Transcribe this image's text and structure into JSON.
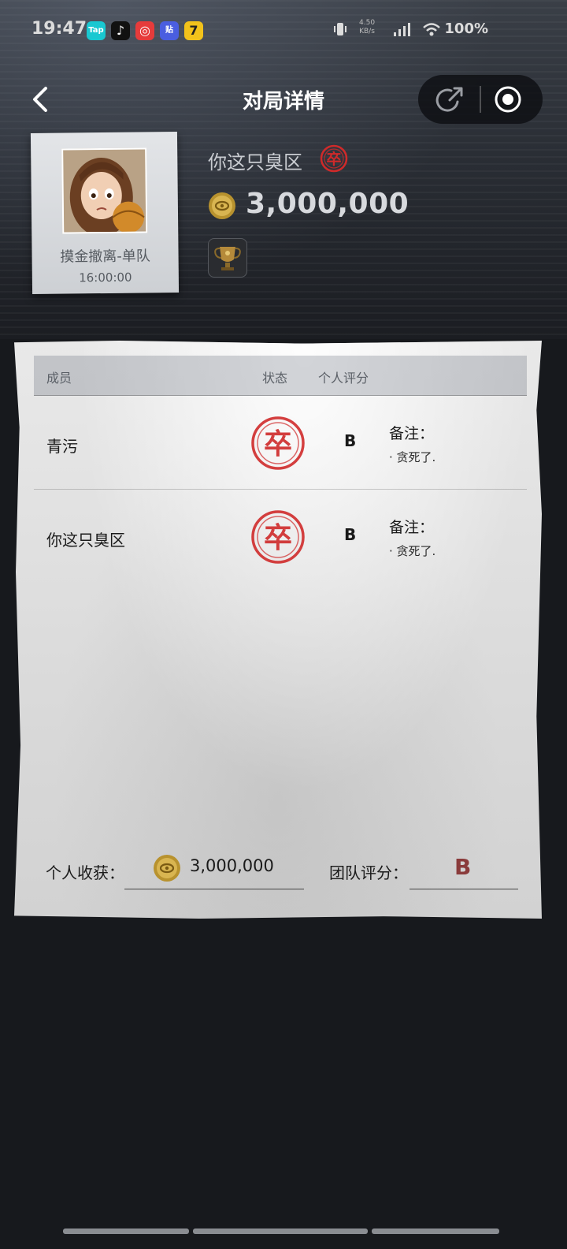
{
  "status_bar": {
    "time": "19:47",
    "apps": [
      {
        "name": "taptap-icon",
        "label": "Tap",
        "color": "#19c8d1"
      },
      {
        "name": "tiktok-icon",
        "label": "♪",
        "color": "#111111"
      },
      {
        "name": "netease-music-icon",
        "label": "◎",
        "color": "#e63b3b"
      },
      {
        "name": "tieba-icon",
        "label": "贴",
        "color": "#4a5ee0"
      },
      {
        "name": "app-7-icon",
        "label": "7",
        "color": "#f2c21b"
      }
    ],
    "net_speed_value": "4.50",
    "net_speed_unit": "KB/s",
    "battery": "100%"
  },
  "nav": {
    "title": "对局详情"
  },
  "profile": {
    "mode": "摸金撤离-单队",
    "time": "16:00:00",
    "player_name": "你这只臭区",
    "gold": "3,000,000"
  },
  "table": {
    "headers": {
      "member": "成员",
      "status": "状态",
      "rating": "个人评分"
    },
    "rows": [
      {
        "name": "青污",
        "status_icon": "dead-stamp-icon",
        "grade": "B",
        "note_label": "备注：",
        "note": "· 贪死了."
      },
      {
        "name": "你这只臭区",
        "status_icon": "dead-stamp-icon",
        "grade": "B",
        "note_label": "备注：",
        "note": "· 贪死了."
      }
    ]
  },
  "footer": {
    "income_label": "个人收获：",
    "income_value": "3,000,000",
    "team_label": "团队评分：",
    "team_grade": "B"
  },
  "colors": {
    "stamp_red": "#cf2a2a",
    "grade_red": "#8a3b3b",
    "coin_gold": "#c9a43a"
  }
}
